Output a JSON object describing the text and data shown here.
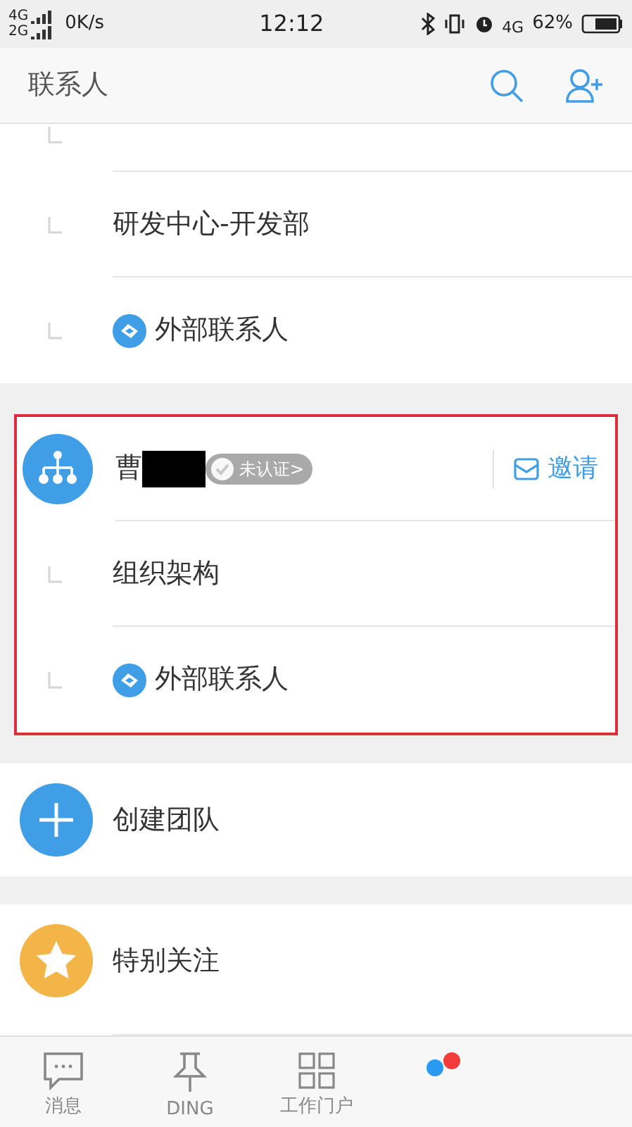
{
  "status_bar": {
    "signal_labels": [
      "4G",
      "2G"
    ],
    "speed": "0K/s",
    "time": "12:12",
    "network": "4G",
    "battery": "62%"
  },
  "header": {
    "title": "联系人"
  },
  "first_team": {
    "sub_items": [
      {
        "kind": "department",
        "label": "研发中心-开发部"
      },
      {
        "kind": "external",
        "label": "外部联系人"
      }
    ]
  },
  "second_team": {
    "name": "曹",
    "name_redacted": true,
    "badge": "未认证>",
    "invite": "邀请",
    "highlighted": true,
    "sub_items": [
      {
        "kind": "department",
        "label": "组织架构"
      },
      {
        "kind": "external",
        "label": "外部联系人"
      }
    ]
  },
  "actions": [
    {
      "kind": "create",
      "label": "创建团队"
    },
    {
      "kind": "star",
      "label": "特别关注"
    }
  ],
  "tabs": [
    {
      "kind": "chat",
      "label": "消息",
      "selected": false
    },
    {
      "kind": "pin",
      "label": "DING",
      "selected": false
    },
    {
      "kind": "grid",
      "label": "工作门户",
      "selected": false
    },
    {
      "kind": "dots",
      "selected": true
    }
  ]
}
